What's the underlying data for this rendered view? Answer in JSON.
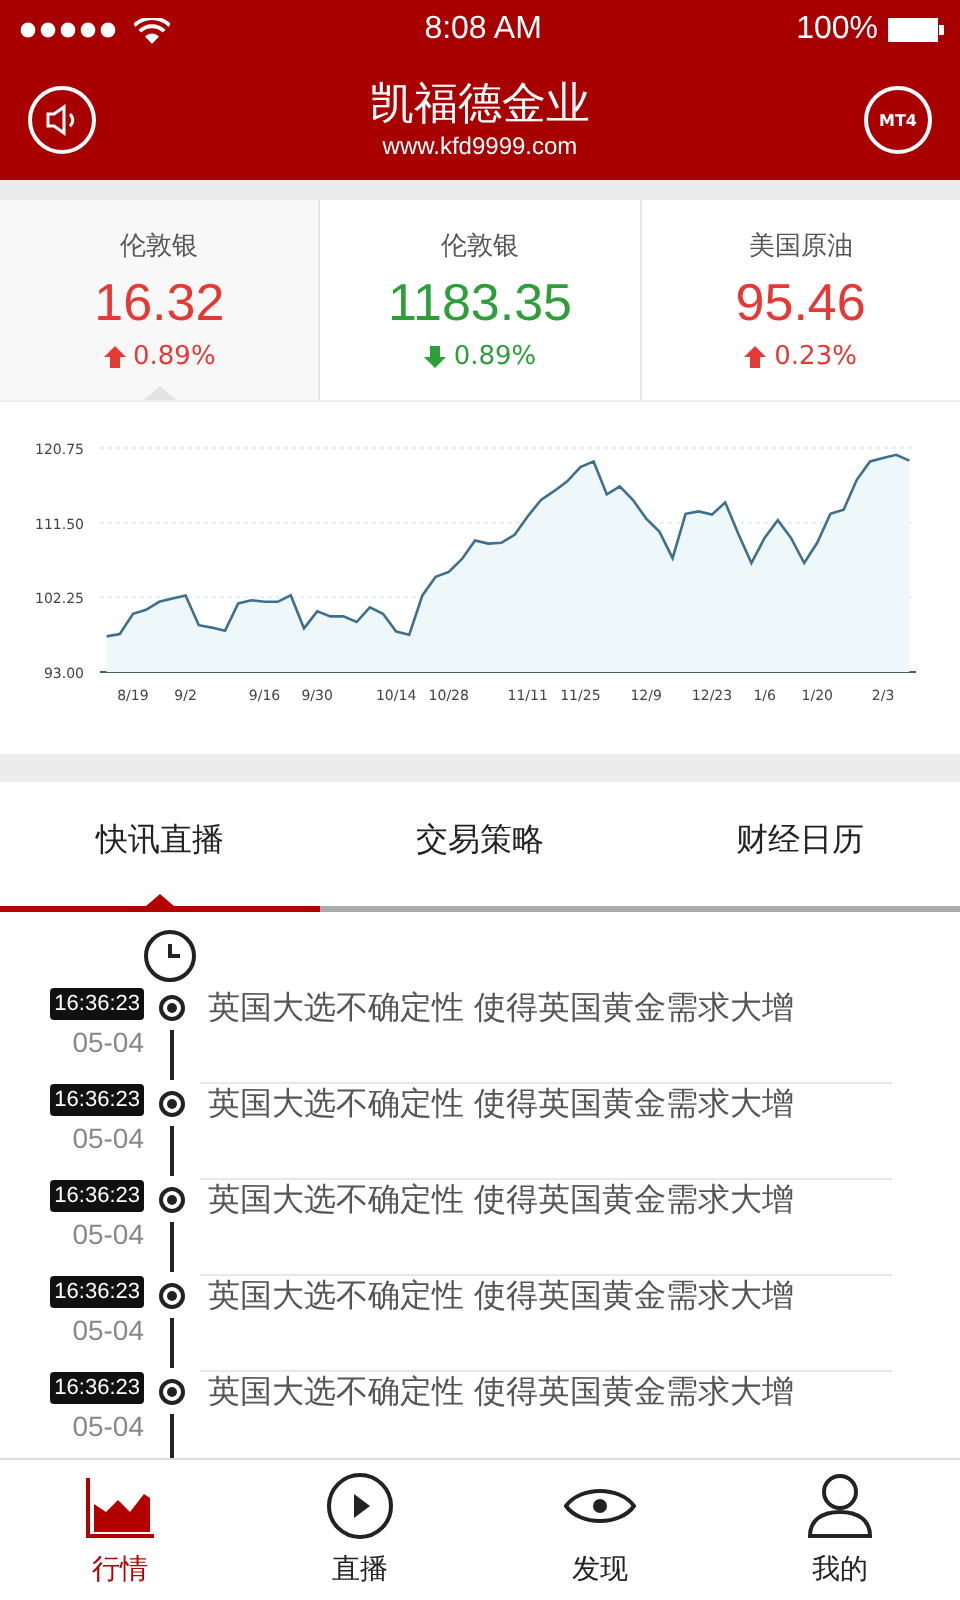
{
  "status_bar": {
    "time": "8:08 AM",
    "battery": "100%"
  },
  "header": {
    "title": "凯福德金业",
    "subtitle": "www.kfd9999.com",
    "right_button": "MT4"
  },
  "quotes": [
    {
      "name": "伦敦银",
      "price": "16.32",
      "change": "0.89%",
      "kind": "up",
      "selected": true
    },
    {
      "name": "伦敦银",
      "price": "1183.35",
      "change": "0.89%",
      "kind": "down",
      "selected": false
    },
    {
      "name": "美国原油",
      "price": "95.46",
      "change": "0.23%",
      "kind": "up",
      "selected": false
    }
  ],
  "chart": {
    "chart_data": {
      "type": "area",
      "categories": [
        null,
        null,
        "8/19",
        null,
        null,
        null,
        "9/2",
        null,
        null,
        null,
        null,
        null,
        "9/16",
        null,
        null,
        null,
        "9/30",
        null,
        null,
        null,
        null,
        null,
        "10/14",
        null,
        null,
        null,
        "10/28",
        null,
        null,
        null,
        null,
        null,
        "11/11",
        null,
        null,
        null,
        "11/25",
        null,
        null,
        null,
        null,
        "12/9",
        null,
        null,
        null,
        null,
        "12/23",
        null,
        null,
        null,
        "1/6",
        null,
        null,
        null,
        "1/20",
        null,
        null,
        null,
        null,
        "2/3",
        null,
        null
      ],
      "series": [
        {
          "color": "#3f6f8c",
          "values": [
            97.4,
            97.7,
            100.2,
            100.7,
            101.7,
            102.1,
            102.5,
            98.8,
            98.5,
            98.1,
            101.5,
            101.9,
            101.7,
            101.7,
            102.5,
            98.4,
            100.5,
            99.9,
            99.9,
            99.2,
            101,
            100.2,
            98,
            97.6,
            102.5,
            104.8,
            105.4,
            107,
            109.3,
            108.9,
            109,
            110,
            112.3,
            114.3,
            115.4,
            116.6,
            118.4,
            119.1,
            115,
            116,
            114.3,
            112,
            110.4,
            107.1,
            112.6,
            112.9,
            112.5,
            114,
            110.1,
            106.5,
            109.6,
            111.8,
            109.6,
            106.5,
            109,
            112.6,
            113.1,
            116.8,
            119.1,
            119.5,
            119.9,
            119.2
          ]
        }
      ],
      "ylim": [
        93,
        120.75
      ],
      "yticks": [
        {
          "value": 93,
          "label": "93.00"
        },
        {
          "value": 102.25,
          "label": "102.25"
        },
        {
          "value": 111.5,
          "label": "111.50"
        },
        {
          "value": 120.75,
          "label": "120.75"
        }
      ]
    }
  },
  "tabs": [
    {
      "label": "快讯直播",
      "selected": true
    },
    {
      "label": "交易策略",
      "selected": false
    },
    {
      "label": "财经日历",
      "selected": false
    }
  ],
  "news": [
    {
      "time": "16:36:23",
      "date": "05-04",
      "text": "英国大选不确定性 使得英国黄金需求大增"
    },
    {
      "time": "16:36:23",
      "date": "05-04",
      "text": "英国大选不确定性 使得英国黄金需求大增"
    },
    {
      "time": "16:36:23",
      "date": "05-04",
      "text": "英国大选不确定性 使得英国黄金需求大增"
    },
    {
      "time": "16:36:23",
      "date": "05-04",
      "text": "英国大选不确定性 使得英国黄金需求大增"
    },
    {
      "time": "16:36:23",
      "date": "05-04",
      "text": "英国大选不确定性 使得英国黄金需求大增"
    }
  ],
  "bottom_nav": [
    {
      "label": "行情",
      "kind": "chart",
      "selected": true
    },
    {
      "label": "直播",
      "kind": "play",
      "selected": false
    },
    {
      "label": "发现",
      "kind": "eye",
      "selected": false
    },
    {
      "label": "我的",
      "kind": "user",
      "selected": false
    }
  ]
}
